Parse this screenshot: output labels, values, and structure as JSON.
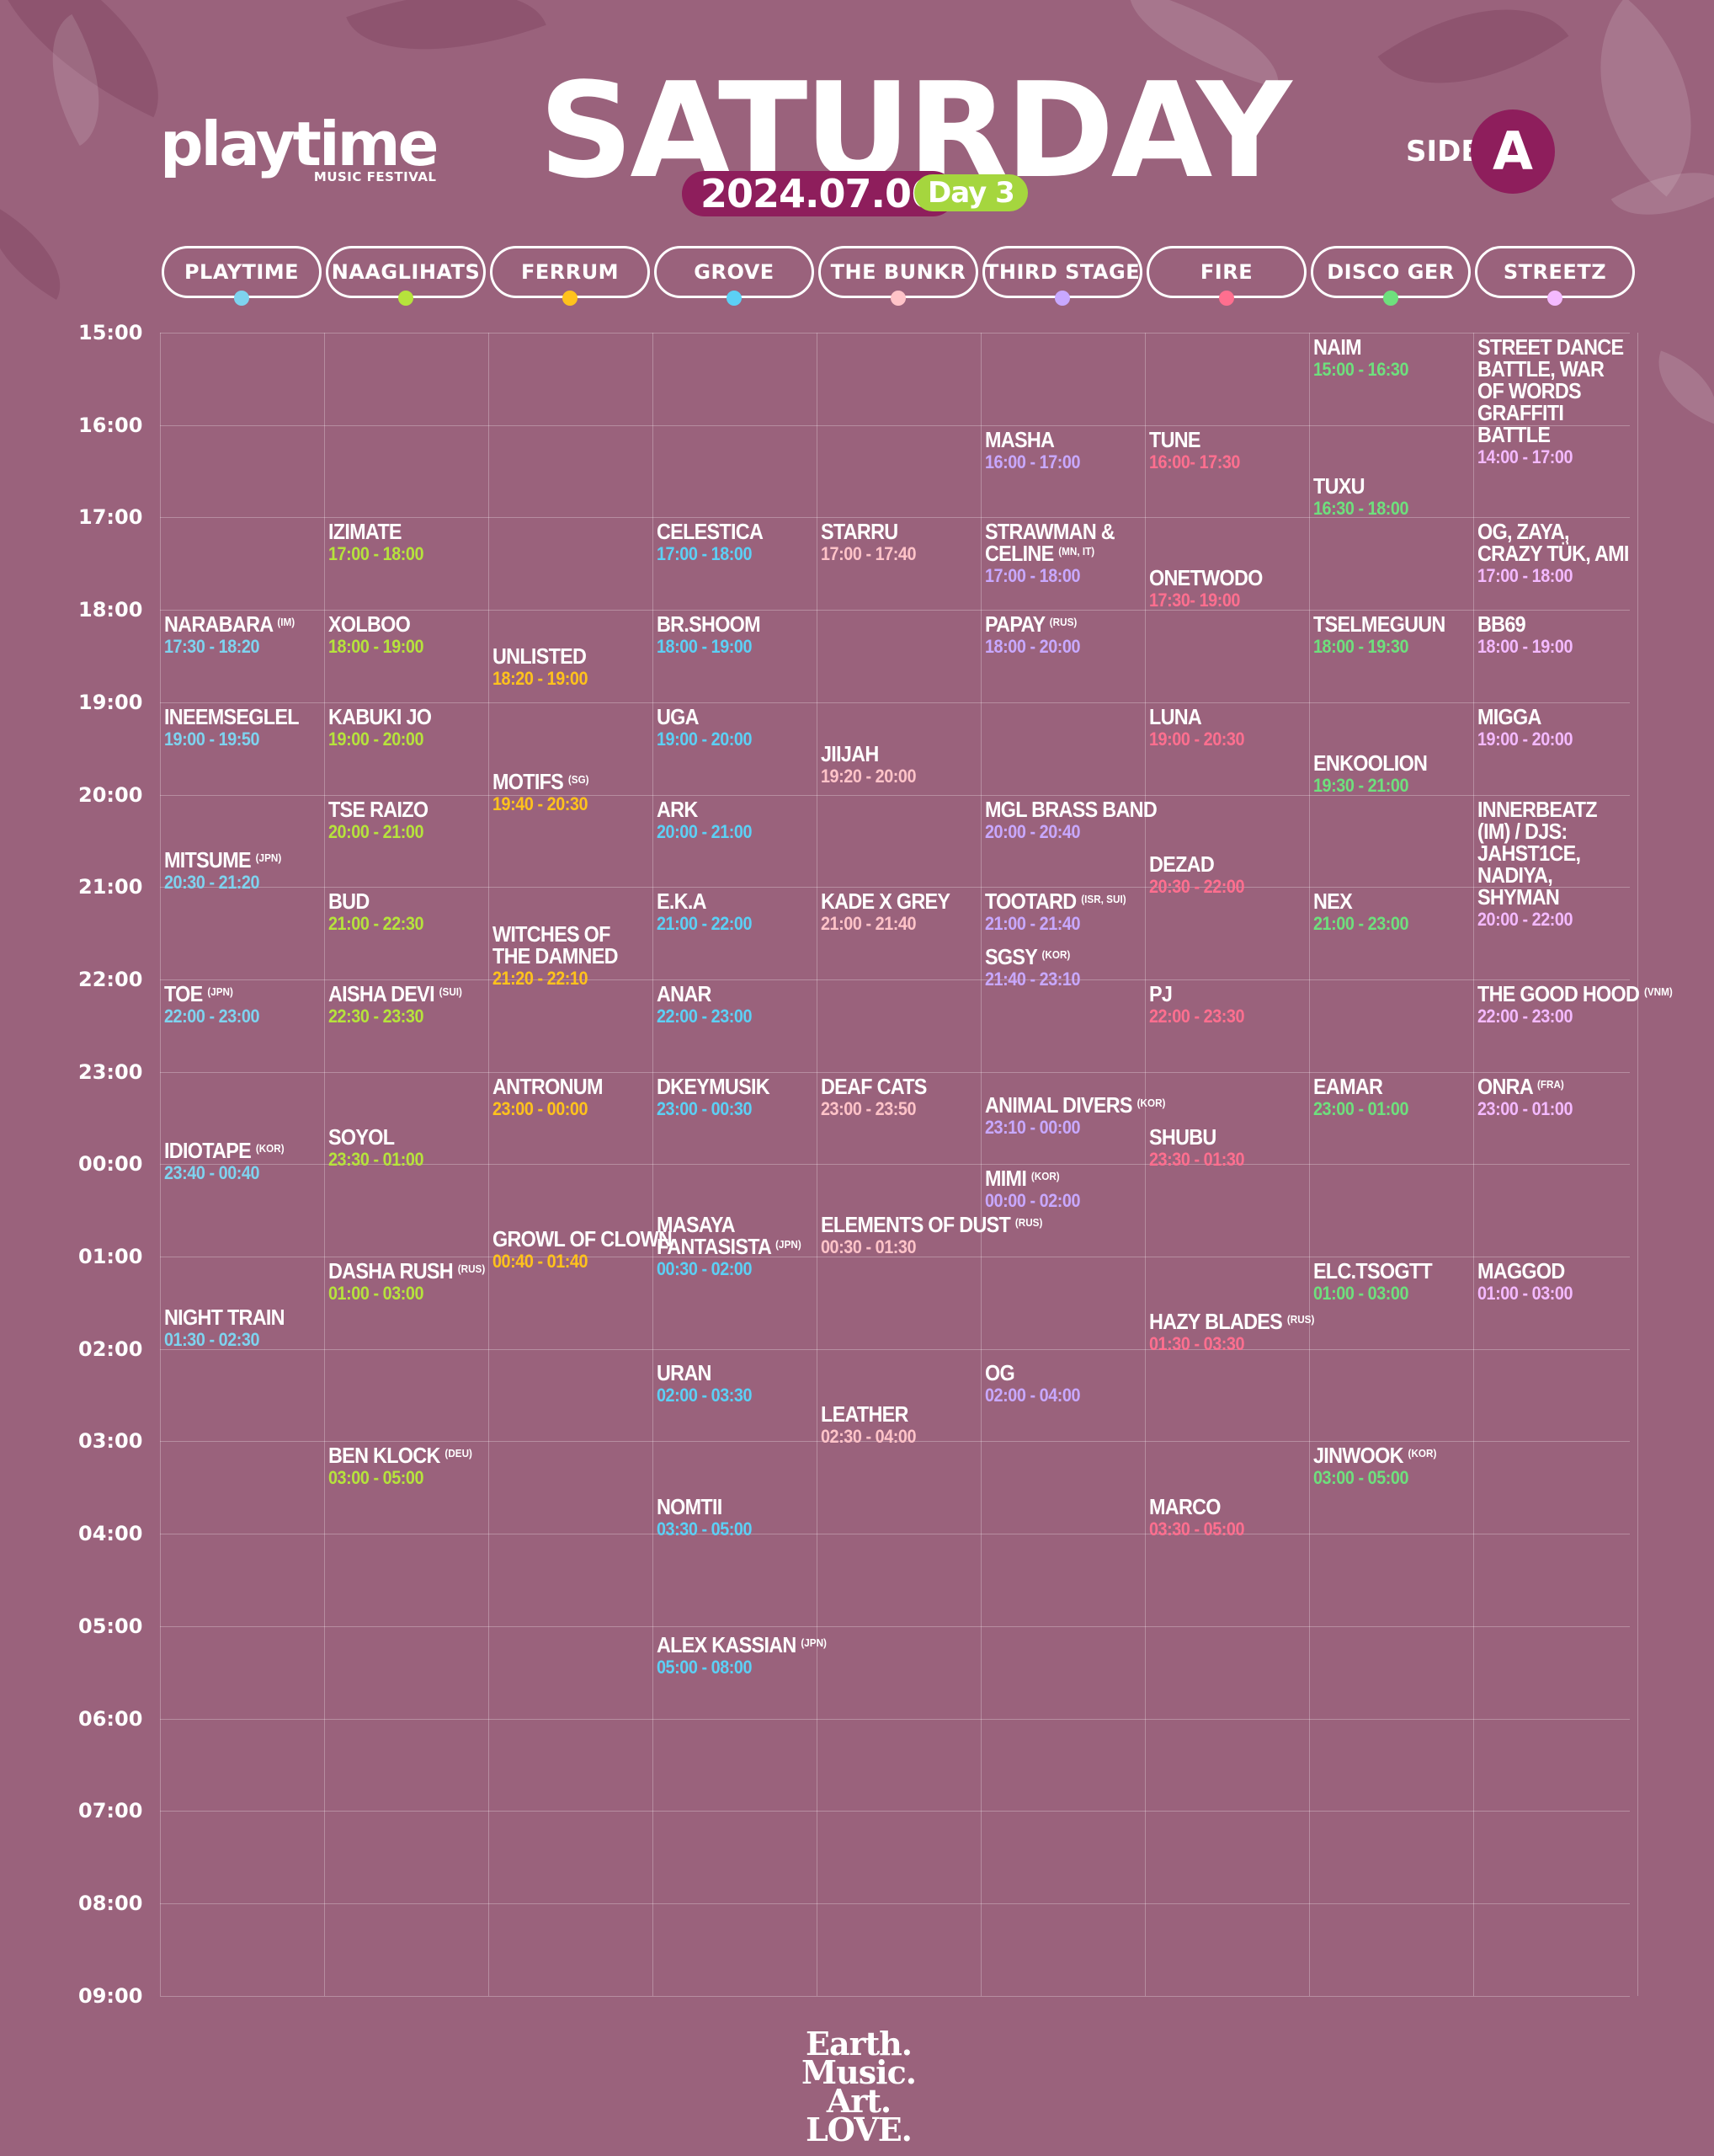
{
  "header": {
    "logo": "playtime",
    "logo_sub": "MUSIC FESTIVAL",
    "title": "SATURDAY",
    "date": "2024.07.06",
    "day": "Day 3",
    "side_label": "SIDE",
    "side_letter": "A"
  },
  "colors": {
    "background": "#9a627c",
    "accent_dark": "#8e1e5c",
    "day_badge": "#a5d63e"
  },
  "stages": [
    {
      "name": "PLAYTIME",
      "color": "#7ed3ef"
    },
    {
      "name": "NAAGLIHATS",
      "color": "#b6e33c"
    },
    {
      "name": "FERRUM",
      "color": "#ffc21c"
    },
    {
      "name": "GROVE",
      "color": "#5cd0f5"
    },
    {
      "name": "THE BUNKR",
      "color": "#ffc3c8"
    },
    {
      "name": "THIRD STAGE",
      "color": "#c8a8ff"
    },
    {
      "name": "FIRE",
      "color": "#ff6f8f"
    },
    {
      "name": "DISCO GER",
      "color": "#6ee07d"
    },
    {
      "name": "STREETZ",
      "color": "#f4b9ff"
    }
  ],
  "times": [
    "15:00",
    "16:00",
    "17:00",
    "18:00",
    "19:00",
    "20:00",
    "21:00",
    "22:00",
    "23:00",
    "00:00",
    "01:00",
    "02:00",
    "03:00",
    "04:00",
    "05:00",
    "06:00",
    "07:00",
    "08:00",
    "09:00"
  ],
  "acts": [
    {
      "stage": 0,
      "name": "NARABARA",
      "tag": "(IM)",
      "time": "17:30 - 18:20",
      "anchor": 3.0
    },
    {
      "stage": 0,
      "name": "INEEMSEGLEL",
      "tag": "",
      "time": "19:00 - 19:50",
      "anchor": 4.0
    },
    {
      "stage": 0,
      "name": "MITSUME",
      "tag": "(JPN)",
      "time": "20:30 - 21:20",
      "anchor": 5.55
    },
    {
      "stage": 0,
      "name": "TOE",
      "tag": "(JPN)",
      "time": "22:00 - 23:00",
      "anchor": 7.0
    },
    {
      "stage": 0,
      "name": "IDIOTAPE",
      "tag": "(KOR)",
      "time": "23:40 - 00:40",
      "anchor": 8.7
    },
    {
      "stage": 0,
      "name": "NIGHT TRAIN",
      "tag": "",
      "time": "01:30 - 02:30",
      "anchor": 10.5
    },
    {
      "stage": 1,
      "name": "IZIMATE",
      "tag": "",
      "time": "17:00 - 18:00",
      "anchor": 2.0
    },
    {
      "stage": 1,
      "name": "XOLBOO",
      "tag": "",
      "time": "18:00 - 19:00",
      "anchor": 3.0
    },
    {
      "stage": 1,
      "name": "KABUKI JO",
      "tag": "",
      "time": "19:00 - 20:00",
      "anchor": 4.0
    },
    {
      "stage": 1,
      "name": "TSE RAIZO",
      "tag": "",
      "time": "20:00 - 21:00",
      "anchor": 5.0
    },
    {
      "stage": 1,
      "name": "BUD",
      "tag": "",
      "time": "21:00 - 22:30",
      "anchor": 6.0
    },
    {
      "stage": 1,
      "name": "AISHA DEVI",
      "tag": "(SUI)",
      "time": "22:30 - 23:30",
      "anchor": 7.0
    },
    {
      "stage": 1,
      "name": "SOYOL",
      "tag": "",
      "time": "23:30 - 01:00",
      "anchor": 8.55
    },
    {
      "stage": 1,
      "name": "DASHA RUSH",
      "tag": "(RUS)",
      "time": "01:00 - 03:00",
      "anchor": 10.0
    },
    {
      "stage": 1,
      "name": "BEN KLOCK",
      "tag": "(DEU)",
      "time": "03:00 - 05:00",
      "anchor": 12.0
    },
    {
      "stage": 2,
      "name": "UNLISTED",
      "tag": "",
      "time": "18:20 - 19:00",
      "anchor": 3.35
    },
    {
      "stage": 2,
      "name": "MOTIFS",
      "tag": "(SG)",
      "time": "19:40 - 20:30",
      "anchor": 4.7
    },
    {
      "stage": 2,
      "name": "WITCHES OF THE DAMNED",
      "tag": "",
      "time": "21:20 - 22:10",
      "anchor": 6.35
    },
    {
      "stage": 2,
      "name": "ANTRONUM",
      "tag": "",
      "time": "23:00 - 00:00",
      "anchor": 8.0
    },
    {
      "stage": 2,
      "name": "GROWL OF CLOWN",
      "tag": "",
      "time": "00:40 - 01:40",
      "anchor": 9.65
    },
    {
      "stage": 3,
      "name": "CELESTICA",
      "tag": "",
      "time": "17:00 - 18:00",
      "anchor": 2.0
    },
    {
      "stage": 3,
      "name": "BR.SHOOM",
      "tag": "",
      "time": "18:00 - 19:00",
      "anchor": 3.0
    },
    {
      "stage": 3,
      "name": "UGA",
      "tag": "",
      "time": "19:00 - 20:00",
      "anchor": 4.0
    },
    {
      "stage": 3,
      "name": "ARK",
      "tag": "",
      "time": "20:00 - 21:00",
      "anchor": 5.0
    },
    {
      "stage": 3,
      "name": "E.K.A",
      "tag": "",
      "time": "21:00 - 22:00",
      "anchor": 6.0
    },
    {
      "stage": 3,
      "name": "ANAR",
      "tag": "",
      "time": "22:00 - 23:00",
      "anchor": 7.0
    },
    {
      "stage": 3,
      "name": "DKEYMUSIK",
      "tag": "",
      "time": "23:00 - 00:30",
      "anchor": 8.0
    },
    {
      "stage": 3,
      "name": "MASAYA FANTASISTA",
      "tag": "(JPN)",
      "time": "00:30 - 02:00",
      "anchor": 9.5
    },
    {
      "stage": 3,
      "name": "URAN",
      "tag": "",
      "time": "02:00 - 03:30",
      "anchor": 11.1
    },
    {
      "stage": 3,
      "name": "NOMTII",
      "tag": "",
      "time": "03:30 - 05:00",
      "anchor": 12.55
    },
    {
      "stage": 3,
      "name": "ALEX KASSIAN",
      "tag": "(JPN)",
      "time": "05:00 - 08:00",
      "anchor": 14.05
    },
    {
      "stage": 4,
      "name": "STARRU",
      "tag": "",
      "time": "17:00 - 17:40",
      "anchor": 2.0
    },
    {
      "stage": 4,
      "name": "JIIJAH",
      "tag": "",
      "time": "19:20 - 20:00",
      "anchor": 4.4
    },
    {
      "stage": 4,
      "name": "KADE X GREY",
      "tag": "",
      "time": "21:00 - 21:40",
      "anchor": 6.0
    },
    {
      "stage": 4,
      "name": "DEAF CATS",
      "tag": "",
      "time": "23:00 - 23:50",
      "anchor": 8.0
    },
    {
      "stage": 4,
      "name": "ELEMENTS OF DUST",
      "tag": "(RUS)",
      "time": "00:30 - 01:30",
      "anchor": 9.5
    },
    {
      "stage": 4,
      "name": "LEATHER",
      "tag": "",
      "time": "02:30 - 04:00",
      "anchor": 11.55
    },
    {
      "stage": 5,
      "name": "MASHA",
      "tag": "",
      "time": "16:00 - 17:00",
      "anchor": 1.0
    },
    {
      "stage": 5,
      "name": "STRAWMAN & CELINE",
      "tag": "(MN, IT)",
      "time": "17:00 - 18:00",
      "anchor": 2.0
    },
    {
      "stage": 5,
      "name": "PAPAY",
      "tag": "(RUS)",
      "time": "18:00 - 20:00",
      "anchor": 3.0
    },
    {
      "stage": 5,
      "name": "MGL BRASS BAND",
      "tag": "",
      "time": "20:00 - 20:40",
      "anchor": 5.0
    },
    {
      "stage": 5,
      "name": "TOOTARD",
      "tag": "(ISR, SUI)",
      "time": "21:00 - 21:40",
      "anchor": 6.0
    },
    {
      "stage": 5,
      "name": "SGSY",
      "tag": "(KOR)",
      "time": "21:40 - 23:10",
      "anchor": 6.6
    },
    {
      "stage": 5,
      "name": "ANIMAL DIVERS",
      "tag": "(KOR)",
      "time": "23:10 - 00:00",
      "anchor": 8.2
    },
    {
      "stage": 5,
      "name": "MIMI",
      "tag": "(KOR)",
      "time": "00:00 - 02:00",
      "anchor": 9.0
    },
    {
      "stage": 5,
      "name": "OG",
      "tag": "",
      "time": "02:00 - 04:00",
      "anchor": 11.1
    },
    {
      "stage": 6,
      "name": "TUNE",
      "tag": "",
      "time": "16:00- 17:30",
      "anchor": 1.0
    },
    {
      "stage": 6,
      "name": "ONETWODO",
      "tag": "",
      "time": "17:30- 19:00",
      "anchor": 2.5
    },
    {
      "stage": 6,
      "name": "LUNA",
      "tag": "",
      "time": "19:00 - 20:30",
      "anchor": 4.0
    },
    {
      "stage": 6,
      "name": "DEZAD",
      "tag": "",
      "time": "20:30 - 22:00",
      "anchor": 5.6
    },
    {
      "stage": 6,
      "name": "PJ",
      "tag": "",
      "time": "22:00 - 23:30",
      "anchor": 7.0
    },
    {
      "stage": 6,
      "name": "SHUBU",
      "tag": "",
      "time": "23:30 - 01:30",
      "anchor": 8.55
    },
    {
      "stage": 6,
      "name": "HAZY BLADES",
      "tag": "(RUS)",
      "time": "01:30 - 03:30",
      "anchor": 10.55
    },
    {
      "stage": 6,
      "name": "MARCO",
      "tag": "",
      "time": "03:30 - 05:00",
      "anchor": 12.55
    },
    {
      "stage": 7,
      "name": "NAIM",
      "tag": "",
      "time": "15:00 - 16:30",
      "anchor": 0.0
    },
    {
      "stage": 7,
      "name": "TUXU",
      "tag": "",
      "time": "16:30 - 18:00",
      "anchor": 1.5
    },
    {
      "stage": 7,
      "name": "TSELMEGUUN",
      "tag": "",
      "time": "18:00 - 19:30",
      "anchor": 3.0
    },
    {
      "stage": 7,
      "name": "ENKOOLION",
      "tag": "",
      "time": "19:30 - 21:00",
      "anchor": 4.5
    },
    {
      "stage": 7,
      "name": "NEX",
      "tag": "",
      "time": "21:00 - 23:00",
      "anchor": 6.0
    },
    {
      "stage": 7,
      "name": "EAMAR",
      "tag": "",
      "time": "23:00 - 01:00",
      "anchor": 8.0
    },
    {
      "stage": 7,
      "name": "ELC.TSOGTT",
      "tag": "",
      "time": "01:00 - 03:00",
      "anchor": 10.0
    },
    {
      "stage": 7,
      "name": "JINWOOK",
      "tag": "(KOR)",
      "time": "03:00 - 05:00",
      "anchor": 12.0
    },
    {
      "stage": 8,
      "name": "STREET DANCE BATTLE, WAR OF WORDS GRAFFITI BATTLE",
      "tag": "",
      "time": "14:00 - 17:00",
      "anchor": 0.0
    },
    {
      "stage": 8,
      "name": "OG, ZAYA, CRAZY TÜK, AMI",
      "tag": "",
      "time": "17:00 - 18:00",
      "anchor": 2.0
    },
    {
      "stage": 8,
      "name": "BB69",
      "tag": "",
      "time": "18:00 - 19:00",
      "anchor": 3.0
    },
    {
      "stage": 8,
      "name": "MIGGA",
      "tag": "",
      "time": "19:00 - 20:00",
      "anchor": 4.0
    },
    {
      "stage": 8,
      "name": "INNERBEATZ (IM) / DJS: JAHST1CE, NADIYA, SHYMAN",
      "tag": "",
      "time": "20:00 - 22:00",
      "anchor": 5.0
    },
    {
      "stage": 8,
      "name": "THE GOOD HOOD",
      "tag": "(VNM)",
      "time": "22:00 - 23:00",
      "anchor": 7.0
    },
    {
      "stage": 8,
      "name": "ONRA",
      "tag": "(FRA)",
      "time": "23:00 - 01:00",
      "anchor": 8.0
    },
    {
      "stage": 8,
      "name": "MAGGOD",
      "tag": "",
      "time": "01:00 - 03:00",
      "anchor": 10.0
    }
  ],
  "footer": {
    "line1": "Earth. Music.",
    "line2": "Art. LOVE."
  }
}
